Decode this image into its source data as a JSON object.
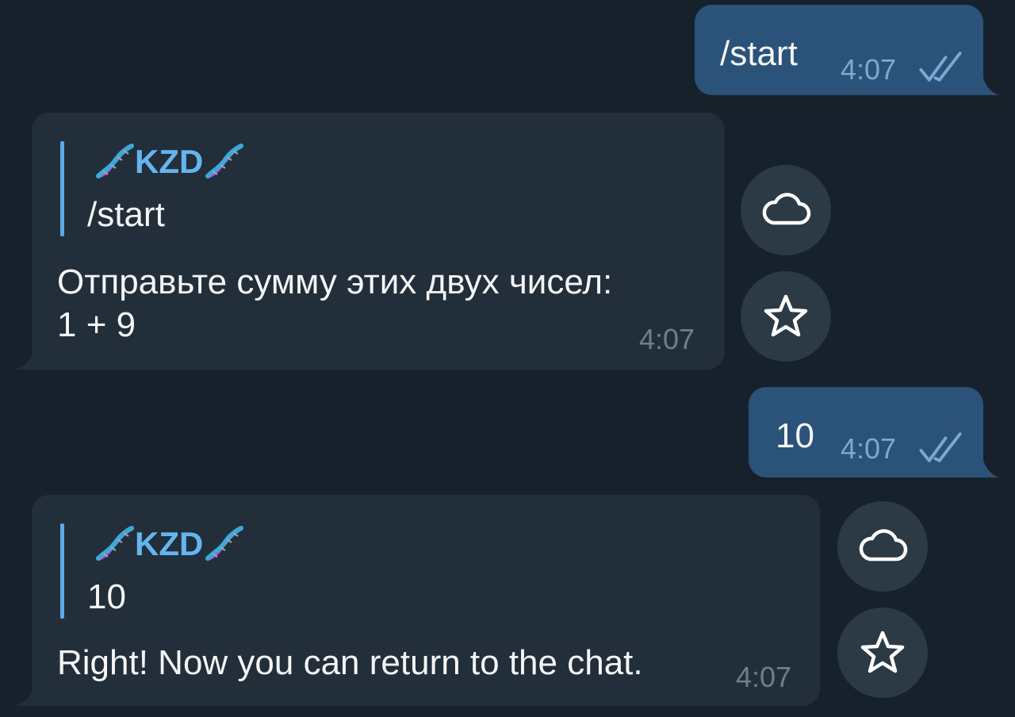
{
  "messages": [
    {
      "text": "/start",
      "time": "4:07"
    },
    {
      "author": "KZD",
      "quote": "/start",
      "text_line1": "Отправьте сумму этих двух чисел:",
      "text_line2": "1 + 9",
      "time": "4:07"
    },
    {
      "text": "10",
      "time": "4:07"
    },
    {
      "author": "KZD",
      "quote": "10",
      "text": "Right! Now you can return to the chat.",
      "time": "4:07"
    }
  ],
  "icons": {
    "cloud": "cloud-icon",
    "star": "star-icon",
    "ticks": "double-check-icon",
    "dna": "dna-emoji-icon"
  },
  "colors": {
    "background": "#17212b",
    "outgoing_bubble": "#2b5278",
    "incoming_bubble": "#222e3a",
    "accent": "#64b5ef"
  }
}
